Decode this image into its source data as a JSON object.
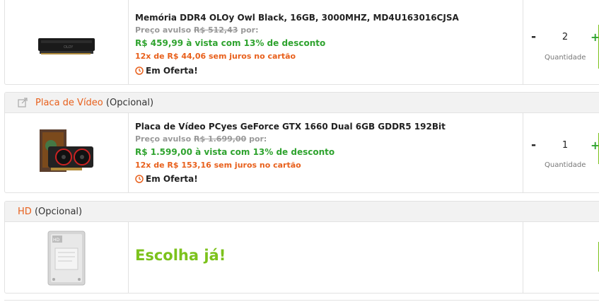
{
  "colors": {
    "accent_orange": "#e8601c",
    "green_price": "#2fa32f",
    "green_action": "#7cc21c",
    "border": "#e2e2e2"
  },
  "memory_item": {
    "title": "Memória DDR4 OLOy Owl Black, 16GB, 3000MHZ, MD4U163016CJSA",
    "old_price_prefix": "Preço avulso",
    "old_price": "R$ 512,43",
    "old_price_suffix": "por:",
    "cash_price": "R$ 459,99 à vista com 13% de desconto",
    "installments": "12x de R$ 44,06 sem juros no cartão",
    "offer": "Em Oferta!",
    "quantity": "2",
    "quantity_label": "Quantidade",
    "minus": "-",
    "plus": "+"
  },
  "gpu_section": {
    "category": "Placa de Vídeo",
    "optional": "(Opcional)",
    "item": {
      "title": "Placa de Vídeo PCyes GeForce GTX 1660 Dual 6GB GDDR5 192Bit",
      "old_price_prefix": "Preço avulso",
      "old_price": "R$ 1.699,00",
      "old_price_suffix": "por:",
      "cash_price": "R$ 1.599,00 à vista com 13% de desconto",
      "installments": "12x de R$ 153,16 sem juros no cartão",
      "offer": "Em Oferta!",
      "quantity": "1",
      "quantity_label": "Quantidade",
      "minus": "-",
      "plus": "+"
    }
  },
  "hd_section": {
    "category": "HD",
    "optional": "(Opcional)",
    "choose_label": "Escolha já!"
  }
}
